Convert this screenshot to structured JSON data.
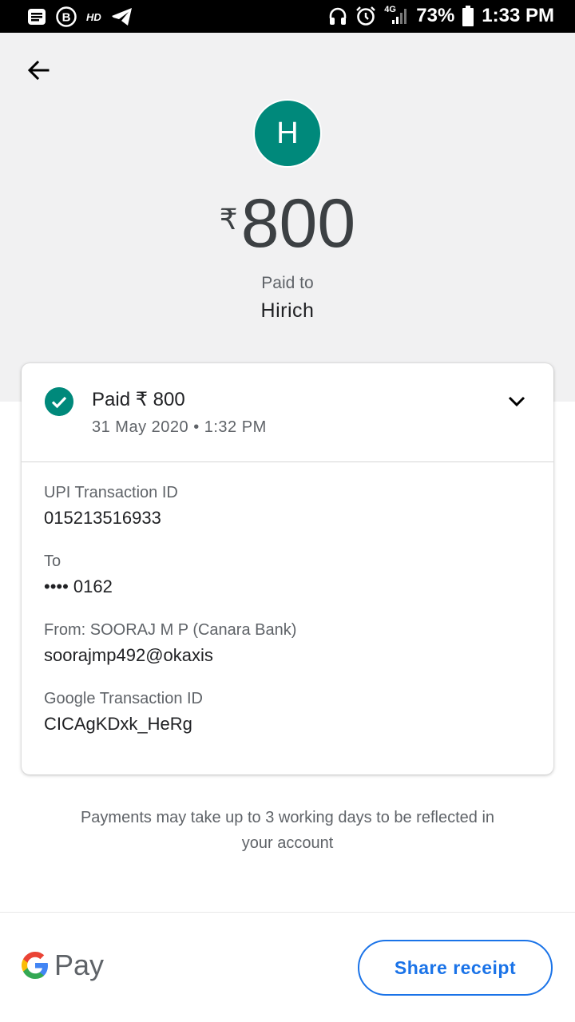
{
  "status_bar": {
    "hd_label": "HD",
    "network": "4G",
    "battery": "73%",
    "time": "1:33 PM"
  },
  "header": {
    "avatar_letter": "H",
    "currency": "₹",
    "amount": "800",
    "paid_to_label": "Paid to",
    "payee_name": "Hirich"
  },
  "summary": {
    "paid_text": "Paid ₹ 800",
    "datetime": "31 May 2020 • 1:32 PM"
  },
  "details": [
    {
      "label": "UPI Transaction ID",
      "value": "015213516933"
    },
    {
      "label": "To",
      "value": "•••• 0162"
    },
    {
      "label": "From: SOORAJ M P (Canara Bank)",
      "value": "soorajmp492@okaxis"
    },
    {
      "label": "Google Transaction ID",
      "value": "CICAgKDxk_HeRg"
    }
  ],
  "note": "Payments may take up to 3 working days to be reflected in your account",
  "footer": {
    "brand_text": "Pay",
    "share_button": "Share receipt"
  },
  "colors": {
    "accent": "#00897b",
    "link": "#1a73e8"
  }
}
